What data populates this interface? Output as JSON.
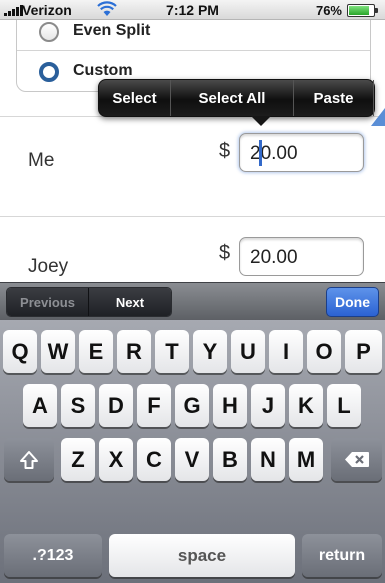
{
  "status_bar": {
    "carrier": "Verizon",
    "time": "7:12 PM",
    "battery_percent": "76%",
    "battery_level": 0.76
  },
  "split_options": {
    "items": [
      {
        "label": "Even Split",
        "selected": false
      },
      {
        "label": "Custom",
        "selected": true
      }
    ]
  },
  "edit_menu": {
    "items": [
      "Select",
      "Select All",
      "Paste"
    ]
  },
  "people": [
    {
      "name": "Me",
      "currency": "$",
      "amount": "20.00"
    },
    {
      "name": "Joey",
      "currency": "$",
      "amount": "20.00"
    }
  ],
  "accessory": {
    "previous_label": "Previous",
    "next_label": "Next",
    "done_label": "Done"
  },
  "keyboard": {
    "row1": [
      "Q",
      "W",
      "E",
      "R",
      "T",
      "Y",
      "U",
      "I",
      "O",
      "P"
    ],
    "row2": [
      "A",
      "S",
      "D",
      "F",
      "G",
      "H",
      "J",
      "K",
      "L"
    ],
    "row3": [
      "Z",
      "X",
      "C",
      "V",
      "B",
      "N",
      "M"
    ],
    "numbers_label": ".?123",
    "space_label": "space",
    "return_label": "return"
  },
  "colors": {
    "accent_blue": "#2b62d2",
    "cursor_blue": "#3369c9",
    "radio_selected": "#2a5f9b"
  }
}
